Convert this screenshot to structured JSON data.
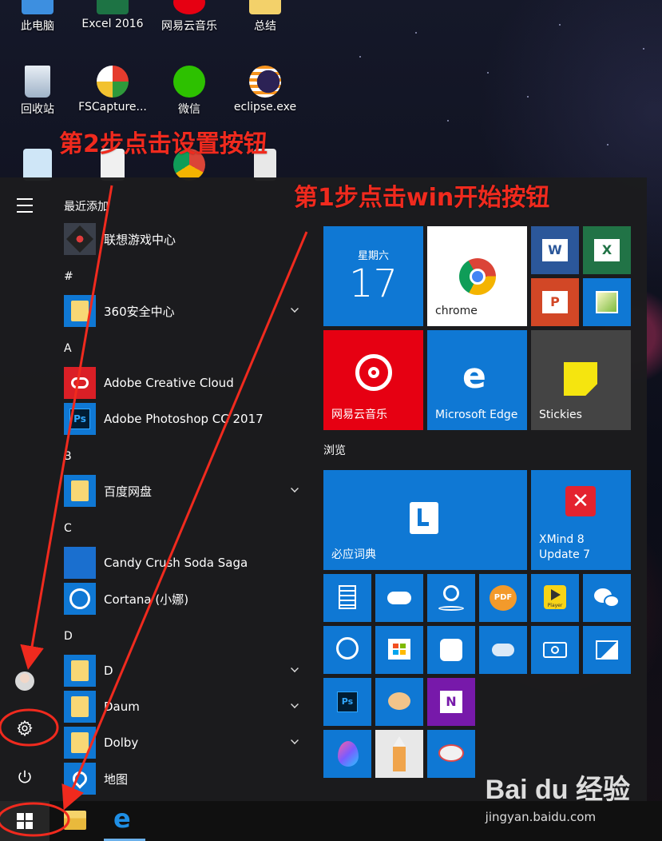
{
  "desktop": {
    "icons_row1": [
      "此电脑",
      "Excel 2016",
      "网易云音乐",
      "总结"
    ],
    "icons_row2": [
      "回收站",
      "FSCapture...",
      "微信",
      "eclipse.exe"
    ]
  },
  "annotations": {
    "step2": "第2步点击设置按钮",
    "step1": "第1步点击win开始按钮"
  },
  "start_menu": {
    "recent_header": "最近添加",
    "apps": {
      "lenovo_game": "联想游戏中心",
      "hash": "#",
      "safe360": "360安全中心",
      "a": "A",
      "adobe_cc": "Adobe Creative Cloud",
      "photoshop": "Adobe Photoshop CC 2017",
      "b": "B",
      "baidu_pan": "百度网盘",
      "c": "C",
      "candy": "Candy Crush Soda Saga",
      "cortana": "Cortana (小娜)",
      "d_header": "D",
      "d_folder": "D",
      "daum": "Daum",
      "dolby": "Dolby",
      "map": "地图"
    },
    "tiles": {
      "calendar_day": "星期六",
      "calendar_date": "17",
      "chrome": "chrome",
      "netease": "网易云音乐",
      "edge": "Microsoft Edge",
      "stickies": "Stickies",
      "browse_header": "浏览",
      "bing_dict": "必应词典",
      "xmind_line1": "XMind 8",
      "xmind_line2": "Update 7",
      "word_letter": "W",
      "excel_letter": "X",
      "ppt_letter": "P",
      "ps_letter": "Ps",
      "onenote_letter": "N",
      "player_text": "Player",
      "pdf_text": "PDF"
    }
  },
  "watermark": {
    "brand": "Bai du 经验",
    "url": "jingyan.baidu.com"
  },
  "colors": {
    "tile_blue": "#0f78d4",
    "netease_red": "#e60012",
    "annotation_red": "#f02a1e"
  }
}
